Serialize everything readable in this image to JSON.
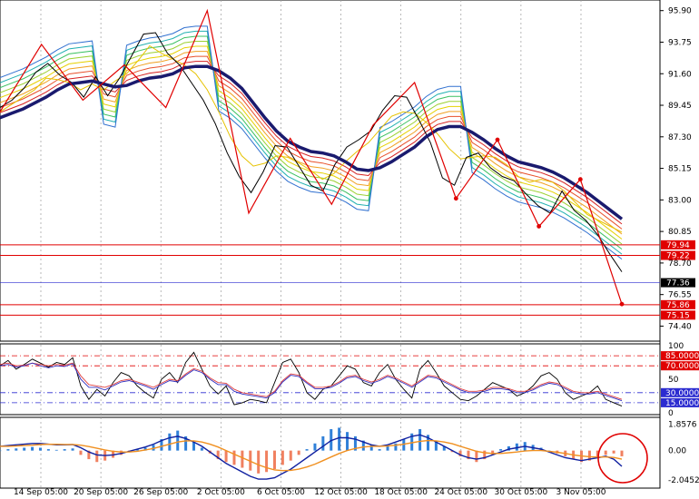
{
  "chart_data": [
    {
      "type": "line",
      "panel": "price",
      "ylim": [
        73.5,
        96.5
      ],
      "y_ticks": [
        "95.90",
        "93.75",
        "91.60",
        "89.45",
        "87.30",
        "85.15",
        "83.00",
        "80.85",
        "78.70",
        "76.55",
        "74.40"
      ],
      "x_ticks": [
        "14 Sep 05:00",
        "20 Sep 05:00",
        "26 Sep 05:00",
        "2 Oct 05:00",
        "6 Oct 05:00",
        "12 Oct 05:00",
        "18 Oct 05:00",
        "24 Oct 05:00",
        "30 Oct 05:00",
        "3 Nov 05:00"
      ],
      "horizontal_levels": [
        {
          "label": "79.94",
          "value": 79.94,
          "color": "#e00000"
        },
        {
          "label": "79.22",
          "value": 79.22,
          "color": "#e00000"
        },
        {
          "label": "77.36",
          "value": 77.36,
          "color": "#2b2bd0",
          "current": true
        },
        {
          "label": "75.86",
          "value": 75.86,
          "color": "#e00000"
        },
        {
          "label": "75.15",
          "value": 75.15,
          "color": "#e00000"
        }
      ],
      "series": [
        {
          "values": [
            88.6,
            88.9,
            89.2,
            89.6,
            90.0,
            90.5,
            90.9,
            91.0,
            91.1,
            90.9,
            90.7,
            90.8,
            91.1,
            91.3,
            91.4,
            91.6,
            92.0,
            92.1,
            92.1,
            91.8,
            91.3,
            90.6,
            89.6,
            88.6,
            87.7,
            87.0,
            86.6,
            86.3,
            86.2,
            86.0,
            85.6,
            85.1,
            85.0,
            85.2,
            85.6,
            86.1,
            86.6,
            87.3,
            87.8,
            88.0,
            88.0,
            87.6,
            87.1,
            86.5,
            86.0,
            85.6,
            85.4,
            85.2,
            84.9,
            84.5,
            84.0,
            83.5,
            82.9,
            82.3,
            81.7
          ],
          "color": "#1a1a6e"
        },
        {
          "values": [
            89.0,
            89.5,
            90.0,
            90.5,
            91.3,
            91.2,
            91.0,
            90.5,
            90.9,
            90.5,
            91.1,
            91.6,
            92.5,
            93.5,
            93.0,
            92.6,
            92.2,
            91.6,
            90.5,
            89.0,
            87.3,
            86.0,
            85.3,
            85.5,
            86.0,
            85.9,
            85.5,
            85.0,
            84.4,
            84.8,
            85.6,
            86.3,
            86.9,
            87.8,
            88.7,
            89.0,
            88.9,
            88.3,
            87.5,
            86.5,
            85.8,
            85.9,
            86.0,
            85.9,
            85.4,
            84.6,
            84.2,
            84.4,
            84.2,
            83.6,
            82.8,
            82.0,
            81.6,
            81.2,
            80.8
          ],
          "color": "#e6c200"
        },
        {
          "values": [
            89.3,
            89.8,
            90.6,
            91.7,
            92.3,
            91.5,
            91.0,
            90.0,
            91.4,
            90.1,
            91.3,
            92.8,
            94.3,
            94.4,
            93.0,
            92.2,
            91.0,
            89.8,
            88.2,
            86.2,
            84.6,
            83.5,
            84.9,
            86.7,
            86.6,
            85.3,
            84.0,
            83.6,
            85.4,
            86.6,
            87.1,
            87.7,
            89.1,
            90.1,
            90.0,
            88.5,
            86.9,
            84.5,
            84.0,
            85.9,
            86.2,
            85.2,
            84.6,
            84.3,
            83.4,
            82.6,
            82.1,
            83.6,
            82.3,
            81.6,
            80.6,
            79.3,
            78.1
          ],
          "color": "#000000"
        }
      ],
      "zigzag": {
        "color": "#e00000",
        "values": [
          89.0,
          93.6,
          89.8,
          92.2,
          89.3,
          95.9,
          82.1,
          87.2,
          82.7,
          88.1,
          91.0,
          83.1,
          87.1,
          81.2,
          84.4,
          75.9
        ]
      },
      "ribbon_colors": [
        "#d62020",
        "#e8502a",
        "#f0a020",
        "#e6d000",
        "#9bd030",
        "#3ac060",
        "#20b0b0",
        "#3070d0"
      ]
    },
    {
      "type": "line",
      "panel": "rsi",
      "ylim": [
        0,
        100
      ],
      "y_ticks": [
        "100",
        "50",
        "0"
      ],
      "horizontal_levels": [
        {
          "label": "85.0000",
          "value": 85,
          "color": "#e00000"
        },
        {
          "label": "70.0000",
          "value": 70,
          "color": "#e00000"
        },
        {
          "label": "30.0000",
          "value": 30,
          "color": "#2b2bd0"
        },
        {
          "label": "15.0000",
          "value": 15,
          "color": "#2b2bd0"
        }
      ],
      "series": [
        {
          "color": "#000000",
          "values": [
            70,
            78,
            65,
            72,
            80,
            74,
            68,
            75,
            72,
            82,
            40,
            20,
            35,
            25,
            45,
            60,
            55,
            40,
            30,
            22,
            50,
            60,
            45,
            75,
            90,
            65,
            40,
            28,
            40,
            12,
            15,
            20,
            18,
            15,
            45,
            75,
            80,
            60,
            30,
            20,
            35,
            40,
            55,
            70,
            65,
            45,
            40,
            60,
            72,
            50,
            35,
            22,
            65,
            78,
            60,
            40,
            30,
            20,
            18,
            25,
            35,
            45,
            40,
            35,
            25,
            30,
            40,
            55,
            60,
            50,
            30,
            20,
            25,
            30,
            40,
            20,
            15,
            10
          ]
        },
        {
          "color": "#e04040",
          "values": [
            72,
            74,
            70,
            71,
            74,
            72,
            70,
            72,
            71,
            74,
            55,
            42,
            40,
            38,
            42,
            48,
            50,
            46,
            42,
            38,
            44,
            50,
            48,
            58,
            66,
            62,
            52,
            45,
            44,
            35,
            30,
            28,
            26,
            24,
            32,
            48,
            58,
            56,
            46,
            38,
            38,
            40,
            46,
            54,
            56,
            50,
            46,
            50,
            56,
            52,
            46,
            40,
            48,
            56,
            54,
            48,
            42,
            36,
            32,
            32,
            34,
            38,
            38,
            36,
            32,
            32,
            36,
            42,
            46,
            44,
            38,
            32,
            30,
            30,
            32,
            28,
            24,
            20
          ]
        },
        {
          "color": "#3030c0",
          "values": [
            70,
            72,
            68,
            70,
            74,
            70,
            67,
            70,
            69,
            73,
            50,
            38,
            38,
            34,
            40,
            46,
            48,
            44,
            40,
            35,
            42,
            48,
            46,
            56,
            64,
            60,
            50,
            42,
            42,
            32,
            28,
            26,
            24,
            22,
            30,
            46,
            56,
            54,
            44,
            36,
            36,
            38,
            44,
            52,
            54,
            48,
            44,
            48,
            54,
            50,
            44,
            38,
            46,
            54,
            52,
            46,
            40,
            34,
            30,
            30,
            32,
            36,
            36,
            34,
            30,
            30,
            34,
            40,
            44,
            42,
            36,
            30,
            28,
            28,
            30,
            26,
            22,
            18
          ]
        }
      ]
    },
    {
      "type": "bar",
      "panel": "macd",
      "ylim": [
        -2.5,
        2.2
      ],
      "y_ticks": [
        "1.8576",
        "0.00",
        "-2.0452"
      ],
      "bar_colors": {
        "up": "#3080d8",
        "down": "#f08060"
      },
      "histogram": [
        0.0,
        0.1,
        0.15,
        0.2,
        0.25,
        0.2,
        0.1,
        0.05,
        0.1,
        0.15,
        -0.3,
        -0.6,
        -0.8,
        -0.7,
        -0.5,
        -0.3,
        -0.1,
        0.1,
        0.2,
        0.4,
        0.8,
        1.2,
        1.4,
        1.0,
        0.6,
        0.2,
        -0.2,
        -0.6,
        -0.8,
        -1.0,
        -1.2,
        -1.4,
        -1.6,
        -1.5,
        -1.3,
        -1.0,
        -0.7,
        -0.3,
        0.1,
        0.5,
        1.0,
        1.5,
        1.6,
        1.3,
        1.0,
        0.7,
        0.4,
        0.1,
        0.3,
        0.5,
        0.8,
        1.2,
        1.5,
        1.1,
        0.7,
        0.3,
        -0.1,
        -0.4,
        -0.6,
        -0.8,
        -0.6,
        -0.3,
        0.1,
        0.3,
        0.5,
        0.6,
        0.4,
        0.2,
        0.0,
        -0.2,
        -0.4,
        -0.6,
        -0.8,
        -0.7,
        -0.5,
        -0.3,
        -0.2,
        -0.4
      ],
      "series": [
        {
          "color": "#1020a0",
          "values": [
            0.3,
            0.35,
            0.4,
            0.45,
            0.5,
            0.5,
            0.45,
            0.4,
            0.4,
            0.42,
            0.2,
            -0.1,
            -0.3,
            -0.35,
            -0.3,
            -0.2,
            -0.05,
            0.1,
            0.25,
            0.45,
            0.7,
            0.9,
            1.0,
            0.85,
            0.6,
            0.3,
            -0.1,
            -0.5,
            -0.9,
            -1.2,
            -1.5,
            -1.8,
            -2.0,
            -2.0,
            -1.9,
            -1.6,
            -1.3,
            -0.9,
            -0.5,
            -0.1,
            0.3,
            0.7,
            0.9,
            0.9,
            0.8,
            0.6,
            0.4,
            0.3,
            0.4,
            0.6,
            0.8,
            1.0,
            1.1,
            0.9,
            0.6,
            0.3,
            0.0,
            -0.3,
            -0.5,
            -0.6,
            -0.5,
            -0.3,
            -0.1,
            0.1,
            0.2,
            0.3,
            0.2,
            0.1,
            -0.1,
            -0.3,
            -0.5,
            -0.6,
            -0.7,
            -0.6,
            -0.5,
            -0.4,
            -0.6,
            -1.1
          ]
        },
        {
          "color": "#f09020",
          "values": [
            0.3,
            0.3,
            0.32,
            0.35,
            0.38,
            0.42,
            0.44,
            0.44,
            0.43,
            0.43,
            0.38,
            0.28,
            0.16,
            0.05,
            -0.05,
            -0.1,
            -0.1,
            -0.05,
            0.05,
            0.15,
            0.3,
            0.45,
            0.6,
            0.68,
            0.68,
            0.6,
            0.45,
            0.25,
            0.0,
            -0.25,
            -0.5,
            -0.75,
            -1.0,
            -1.2,
            -1.35,
            -1.4,
            -1.38,
            -1.3,
            -1.15,
            -0.95,
            -0.7,
            -0.45,
            -0.2,
            0.0,
            0.15,
            0.25,
            0.3,
            0.3,
            0.32,
            0.38,
            0.45,
            0.55,
            0.65,
            0.7,
            0.68,
            0.6,
            0.48,
            0.3,
            0.12,
            -0.05,
            -0.15,
            -0.2,
            -0.2,
            -0.15,
            -0.1,
            -0.03,
            0.0,
            0.0,
            -0.05,
            -0.12,
            -0.2,
            -0.3,
            -0.38,
            -0.43,
            -0.45,
            -0.45,
            -0.48,
            -0.6
          ]
        }
      ]
    }
  ]
}
